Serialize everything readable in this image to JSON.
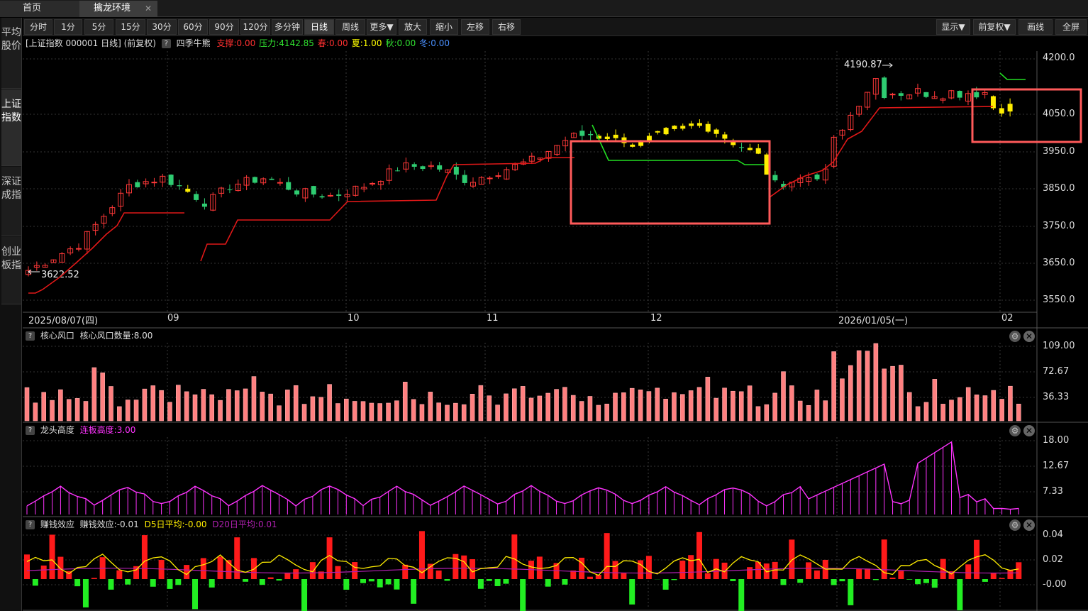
{
  "tabs": [
    {
      "label": "首页"
    },
    {
      "label": "擒龙环境"
    }
  ],
  "tab_close": "✕",
  "toolbar_left": [
    "分时",
    "1分",
    "5分",
    "15分",
    "30分",
    "60分",
    "90分",
    "120分",
    "多分钟",
    "日线",
    "周线",
    "更多▼",
    "放大",
    "缩小",
    "左移",
    "右移"
  ],
  "toolbar_active": "日线",
  "toolbar_right": [
    "显示▼",
    "前复权▼",
    "画线",
    "全屏"
  ],
  "sidebar": [
    "平均股价",
    "上证指数",
    "深证成指",
    "创业板指"
  ],
  "sidebar_active": "上证指数",
  "main": {
    "title": "[上证指数 000001 日线]  (前复权)",
    "indicator": "四季牛熊",
    "ind": [
      {
        "text": "支撑:0.00",
        "color": "#ff3030"
      },
      {
        "text": "压力:4142.85",
        "color": "#30e030"
      },
      {
        "text": "春:0.00",
        "color": "#ff3030"
      },
      {
        "text": "夏:1.00",
        "color": "#ffff00"
      },
      {
        "text": "秋:0.00",
        "color": "#30e030"
      },
      {
        "text": "冬:0.00",
        "color": "#4a90ff"
      }
    ],
    "high_label": "4190.87",
    "low_label": "3622.52",
    "y_ticks": [
      "4200.0",
      "4050.0",
      "3950.0",
      "3850.0",
      "3750.0",
      "3650.0",
      "3550.0"
    ],
    "x_ticks": [
      "2025/08/07(四)",
      "09",
      "10",
      "11",
      "12",
      "2026/01/05(一)",
      "02"
    ]
  },
  "panel1": {
    "name": "核心风口",
    "label": "核心风口数量:8.00",
    "y_ticks": [
      "109.00",
      "72.67",
      "36.33"
    ]
  },
  "panel2": {
    "name": "龙头高度",
    "label": "连板高度:3.00",
    "y_ticks": [
      "18.00",
      "12.67",
      "7.33"
    ]
  },
  "panel3": {
    "name": "赚钱效应",
    "label": "赚钱效应:-0.01",
    "d5": "D5日平均:-0.00",
    "d20": "D20日平均:0.01",
    "y_ticks": [
      "0.04",
      "0.02",
      "-0.00"
    ]
  },
  "colors": {
    "up": "#ff3838",
    "down": "#2ecc71",
    "yellow": "#ffee00",
    "support": "#e01818",
    "pressure": "#22dd22",
    "magenta": "#ff33ff",
    "highlight": "#ff5a5a"
  }
}
